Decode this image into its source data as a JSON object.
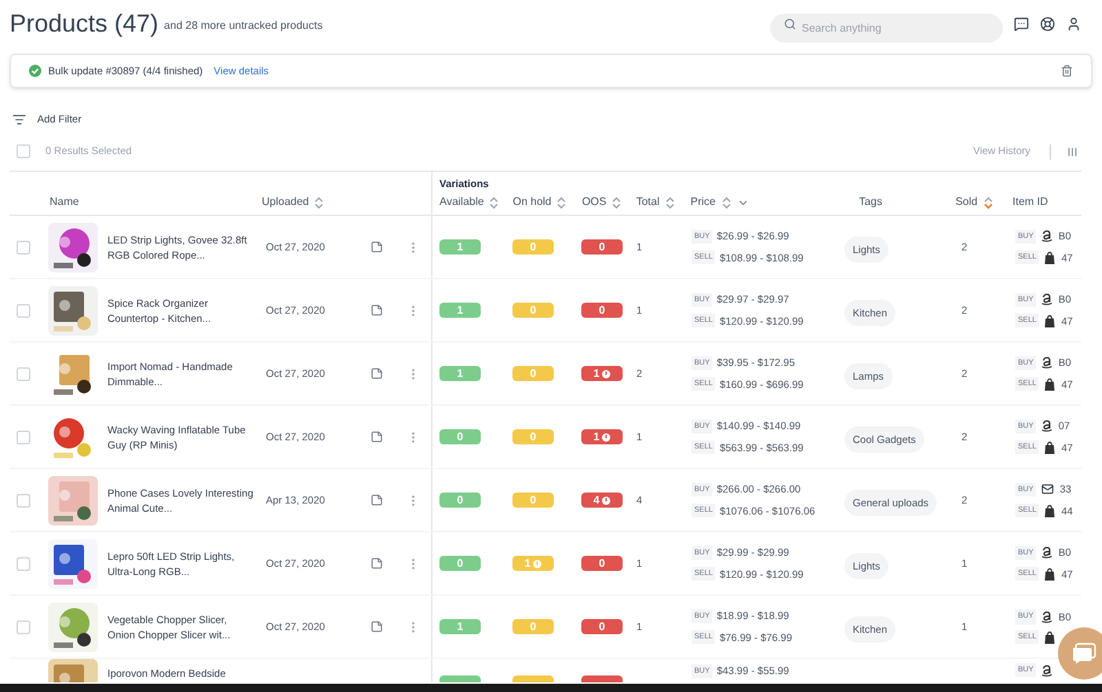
{
  "header": {
    "title": "Products (47)",
    "subtitle": "and 28 more untracked products",
    "search": {
      "placeholder": "Search anything"
    }
  },
  "banner": {
    "text": "Bulk update #30897 (4/4 finished)",
    "link": "View details"
  },
  "filter": {
    "label": "Add Filter"
  },
  "selection": {
    "label": "0 Results Selected",
    "checked": false,
    "history": "View History"
  },
  "table": {
    "group_heading": "Variations",
    "columns": [
      {
        "label": "Name",
        "sortable": false
      },
      {
        "label": "Uploaded",
        "sortable": true,
        "sorted": false
      },
      {
        "label": "Available",
        "sortable": true,
        "sorted": false
      },
      {
        "label": "On hold",
        "sortable": true,
        "sorted": false
      },
      {
        "label": "OOS",
        "sortable": true,
        "sorted": false
      },
      {
        "label": "Total",
        "sortable": true,
        "sorted": false
      },
      {
        "label": "Price",
        "sortable": true,
        "sorted": false
      },
      {
        "label": "Tags",
        "sortable": false
      },
      {
        "label": "Sold",
        "sortable": true,
        "sorted": true
      },
      {
        "label": "Item ID",
        "sortable": false
      }
    ],
    "rows": [
      {
        "checked": false,
        "name": "LED Strip Lights, Govee 32.8ft RGB Colored Rope...",
        "uploaded": "Oct 27, 2020",
        "available": {
          "value": "1",
          "alert": false
        },
        "on_hold": {
          "value": "0",
          "alert": false
        },
        "oos": {
          "value": "0",
          "alert": false
        },
        "total": "1",
        "buy_label": "BUY",
        "buy": "$26.99 - $26.99",
        "sell_label": "SELL",
        "sell": "$108.99 - $108.99",
        "tag": "Lights",
        "sold": "2",
        "ids": [
          {
            "label": "BUY",
            "kind": "amazon",
            "value": "B0"
          },
          {
            "label": "SELL",
            "kind": "shopify",
            "value": "47"
          }
        ]
      },
      {
        "checked": false,
        "name": "Spice Rack Organizer Countertop - Kitchen...",
        "uploaded": "Oct 27, 2020",
        "available": {
          "value": "1",
          "alert": false
        },
        "on_hold": {
          "value": "0",
          "alert": false
        },
        "oos": {
          "value": "0",
          "alert": false
        },
        "total": "1",
        "buy_label": "BUY",
        "buy": "$29.97 - $29.97",
        "sell_label": "SELL",
        "sell": "$120.99 - $120.99",
        "tag": "Kitchen",
        "sold": "2",
        "ids": [
          {
            "label": "BUY",
            "kind": "amazon",
            "value": "B0"
          },
          {
            "label": "SELL",
            "kind": "shopify",
            "value": "47"
          }
        ]
      },
      {
        "checked": false,
        "name": "Import Nomad - Handmade Dimmable...",
        "uploaded": "Oct 27, 2020",
        "available": {
          "value": "1",
          "alert": false
        },
        "on_hold": {
          "value": "0",
          "alert": false
        },
        "oos": {
          "value": "1",
          "alert": true
        },
        "total": "2",
        "buy_label": "BUY",
        "buy": "$39.95 - $172.95",
        "sell_label": "SELL",
        "sell": "$160.99 - $696.99",
        "tag": "Lamps",
        "sold": "2",
        "ids": [
          {
            "label": "BUY",
            "kind": "amazon",
            "value": "B0"
          },
          {
            "label": "SELL",
            "kind": "shopify",
            "value": "47"
          }
        ]
      },
      {
        "checked": false,
        "name": "Wacky Waving Inflatable Tube Guy (RP Minis)",
        "uploaded": "Oct 27, 2020",
        "available": {
          "value": "0",
          "alert": false
        },
        "on_hold": {
          "value": "0",
          "alert": false
        },
        "oos": {
          "value": "1",
          "alert": true
        },
        "total": "1",
        "buy_label": "BUY",
        "buy": "$140.99 - $140.99",
        "sell_label": "SELL",
        "sell": "$563.99 - $563.99",
        "tag": "Cool Gadgets",
        "sold": "2",
        "ids": [
          {
            "label": "BUY",
            "kind": "amazon",
            "value": "07"
          },
          {
            "label": "SELL",
            "kind": "shopify",
            "value": "47"
          }
        ]
      },
      {
        "checked": false,
        "name": "Phone Cases Lovely Interesting Animal Cute...",
        "uploaded": "Apr 13, 2020",
        "available": {
          "value": "0",
          "alert": false
        },
        "on_hold": {
          "value": "0",
          "alert": false
        },
        "oos": {
          "value": "4",
          "alert": true
        },
        "total": "4",
        "buy_label": "BUY",
        "buy": "$266.00 - $266.00",
        "sell_label": "SELL",
        "sell": "$1076.06 - $1076.06",
        "tag": "General uploads",
        "sold": "2",
        "ids": [
          {
            "label": "BUY",
            "kind": "mail",
            "value": "33"
          },
          {
            "label": "SELL",
            "kind": "shopify",
            "value": "44"
          }
        ]
      },
      {
        "checked": false,
        "name": "Lepro 50ft LED Strip Lights, Ultra-Long RGB...",
        "uploaded": "Oct 27, 2020",
        "available": {
          "value": "0",
          "alert": false
        },
        "on_hold": {
          "value": "1",
          "alert": true
        },
        "oos": {
          "value": "0",
          "alert": false
        },
        "total": "1",
        "buy_label": "BUY",
        "buy": "$29.99 - $29.99",
        "sell_label": "SELL",
        "sell": "$120.99 - $120.99",
        "tag": "Lights",
        "sold": "1",
        "ids": [
          {
            "label": "BUY",
            "kind": "amazon",
            "value": "B0"
          },
          {
            "label": "SELL",
            "kind": "shopify",
            "value": "47"
          }
        ]
      },
      {
        "checked": false,
        "name": "Vegetable Chopper Slicer, Onion Chopper Slicer wit...",
        "uploaded": "Oct 27, 2020",
        "available": {
          "value": "1",
          "alert": false
        },
        "on_hold": {
          "value": "0",
          "alert": false
        },
        "oos": {
          "value": "0",
          "alert": false
        },
        "total": "1",
        "buy_label": "BUY",
        "buy": "$18.99 - $18.99",
        "sell_label": "SELL",
        "sell": "$76.99 - $76.99",
        "tag": "Kitchen",
        "sold": "1",
        "ids": [
          {
            "label": "BUY",
            "kind": "amazon",
            "value": "B0"
          },
          {
            "label": "SELL",
            "kind": "shopify"
          }
        ]
      }
    ],
    "partial_row": {
      "name": "Iporovon Modern Bedside",
      "buy_label": "BUY",
      "buy": "$43.99 - $55.99",
      "ids": [
        {
          "label": "BUY",
          "kind": "amazon"
        }
      ]
    }
  }
}
